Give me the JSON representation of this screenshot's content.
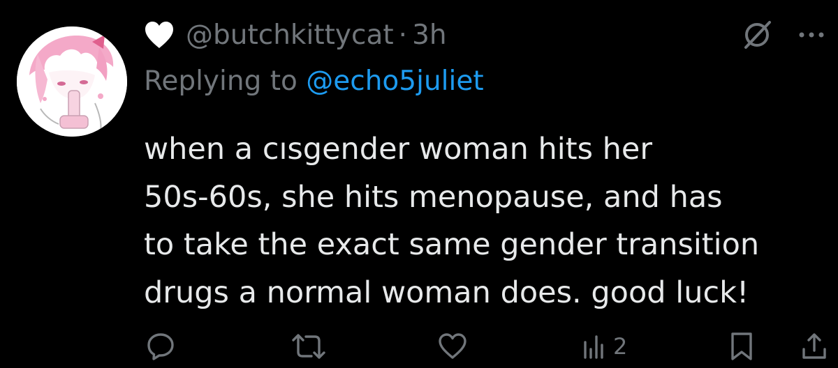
{
  "tweet": {
    "handle": "@butchkittycat",
    "separator": "·",
    "time": "3h",
    "reply_prefix": "Replying to ",
    "reply_mention": "@echo5juliet",
    "lines": [
      "when a cısgender woman hits her",
      "50s-60s, she hits menopause, and has",
      "to take the exact same gender transition",
      "drugs a normal woman does. good luck!"
    ]
  },
  "actions": {
    "views_count": "2"
  },
  "icons": {
    "name_badge": "heart-icon",
    "top_right": [
      "grok-icon",
      "more-icon"
    ],
    "action_bar": [
      "reply-icon",
      "retweet-icon",
      "like-icon",
      "views-icon",
      "bookmark-icon",
      "share-icon"
    ]
  },
  "colors": {
    "background": "#000000",
    "text": "#e7e9ea",
    "secondary": "#71767b",
    "mention": "#1d9bf0",
    "avatar_accent": "#f4a9c8"
  }
}
